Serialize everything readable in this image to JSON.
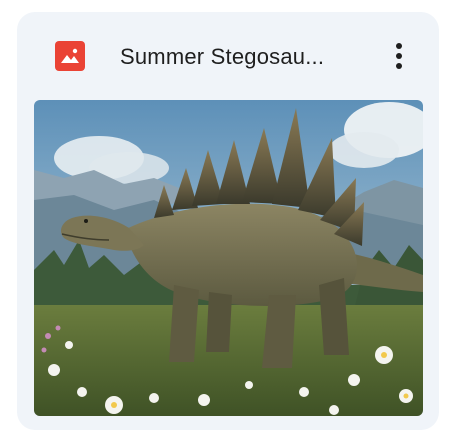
{
  "file_card": {
    "title": "Summer Stegosau...",
    "file_type_icon": "image-file-icon",
    "more_menu_icon": "more-vert-icon",
    "thumbnail_alt": "Stegosaurus in a meadow",
    "colors": {
      "card_background": "#f0f4f9",
      "file_icon": "#ea4335",
      "title_text": "#1f1f1f"
    }
  }
}
